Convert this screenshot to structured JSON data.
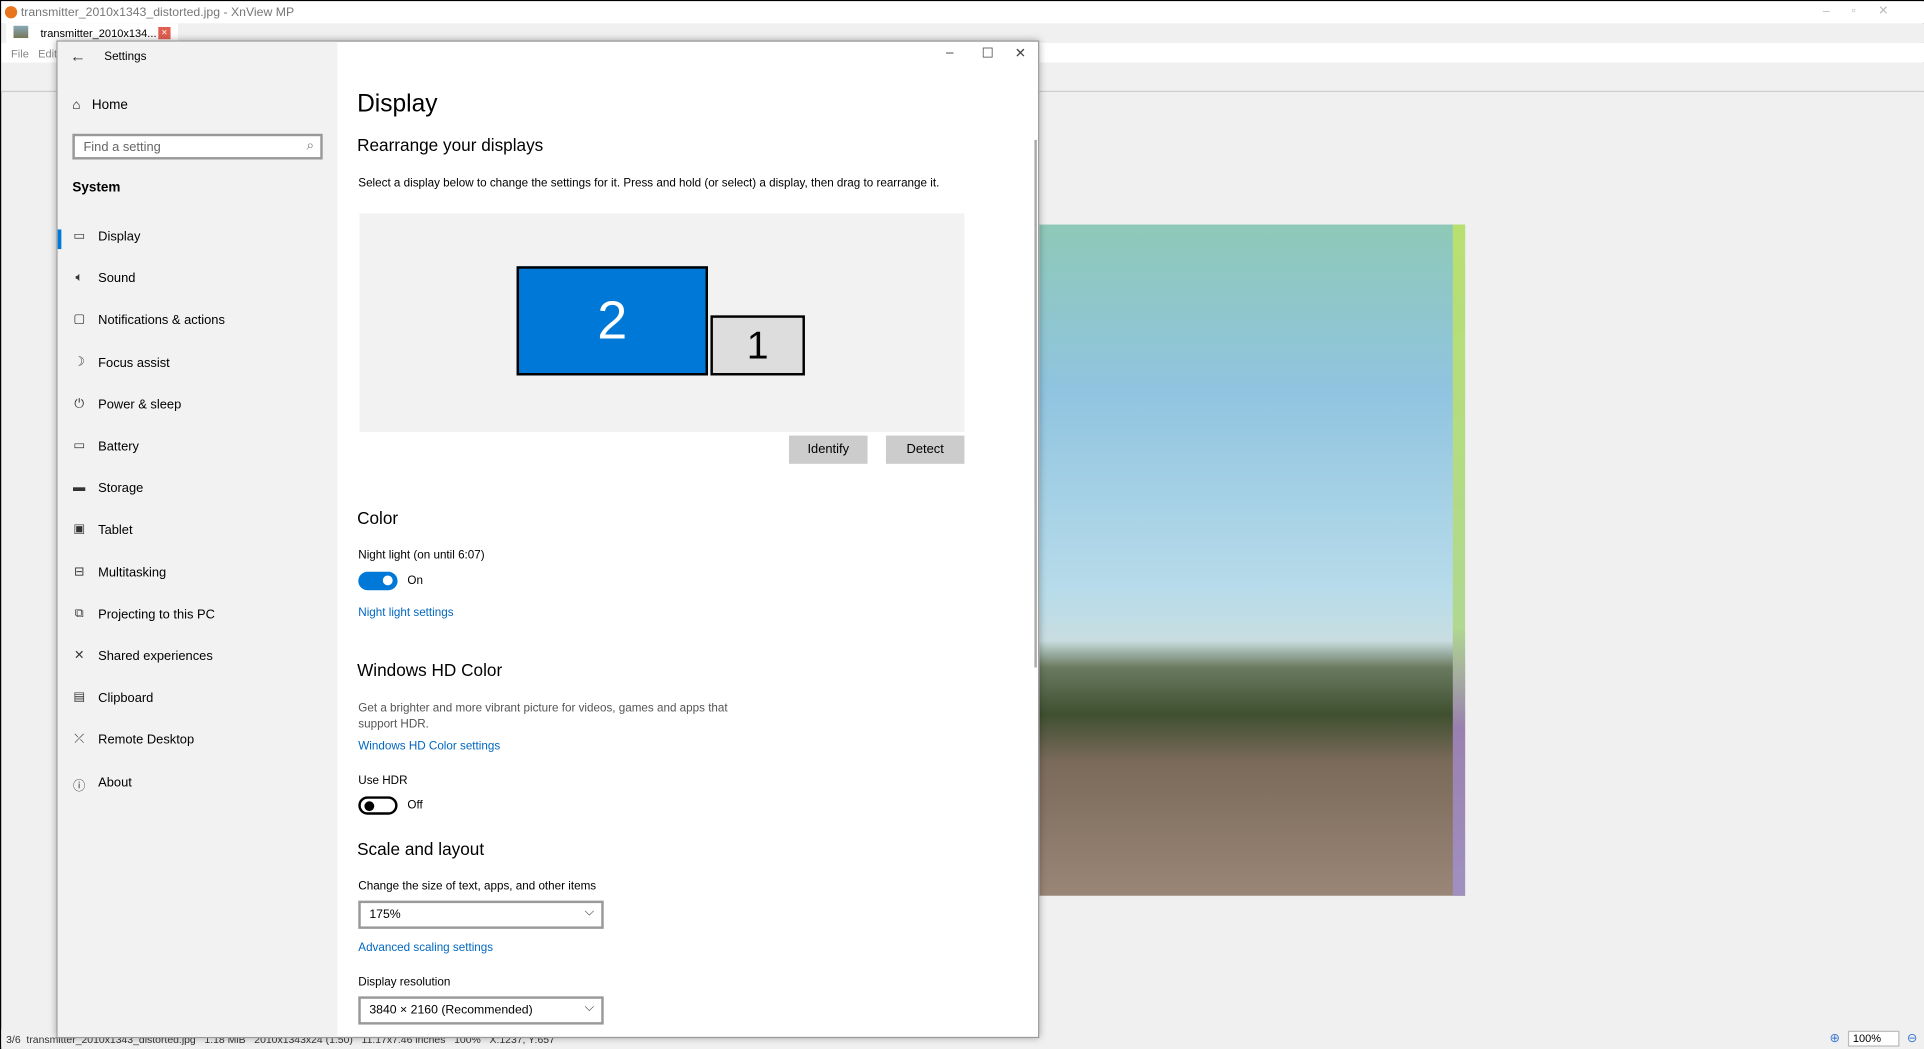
{
  "xnview": {
    "title": "transmitter_2010x1343_distorted.jpg - XnView MP",
    "tab_label": "transmitter_2010x134...",
    "menu": [
      "File",
      "Edit"
    ],
    "status": "3/6  transmitter_2010x1343_distorted.jpg   1.18 MiB   2010x1343x24 (1.50)   11.17x7.46 inches   100%   X:1237, Y:657",
    "zoom": "100%"
  },
  "settings": {
    "window_title": "Settings",
    "home": "Home",
    "search_placeholder": "Find a setting",
    "section": "System",
    "nav": [
      {
        "label": "Display",
        "icon": "monitor-icon"
      },
      {
        "label": "Sound",
        "icon": "speaker-icon"
      },
      {
        "label": "Notifications & actions",
        "icon": "notification-icon"
      },
      {
        "label": "Focus assist",
        "icon": "moon-icon"
      },
      {
        "label": "Power & sleep",
        "icon": "power-icon"
      },
      {
        "label": "Battery",
        "icon": "battery-icon"
      },
      {
        "label": "Storage",
        "icon": "storage-icon"
      },
      {
        "label": "Tablet",
        "icon": "tablet-icon"
      },
      {
        "label": "Multitasking",
        "icon": "multitasking-icon"
      },
      {
        "label": "Projecting to this PC",
        "icon": "projecting-icon"
      },
      {
        "label": "Shared experiences",
        "icon": "shared-icon"
      },
      {
        "label": "Clipboard",
        "icon": "clipboard-icon"
      },
      {
        "label": "Remote Desktop",
        "icon": "remote-desktop-icon"
      },
      {
        "label": "About",
        "icon": "info-icon"
      }
    ],
    "page_title": "Display",
    "rearrange_heading": "Rearrange your displays",
    "rearrange_desc": "Select a display below to change the settings for it. Press and hold (or select) a display, then drag to rearrange it.",
    "monitor_2": "2",
    "monitor_1": "1",
    "identify": "Identify",
    "detect": "Detect",
    "color_heading": "Color",
    "night_light_label": "Night light (on until 6:07)",
    "night_light_state": "On",
    "night_light_link": "Night light settings",
    "hd_heading": "Windows HD Color",
    "hd_desc": "Get a brighter and more vibrant picture for videos, games and apps that support HDR.",
    "hd_link": "Windows HD Color settings",
    "hdr_label": "Use HDR",
    "hdr_state": "Off",
    "scale_heading": "Scale and layout",
    "scale_label": "Change the size of text, apps, and other items",
    "scale_value": "175%",
    "adv_scaling_link": "Advanced scaling settings",
    "resolution_label": "Display resolution",
    "resolution_value": "3840 × 2160 (Recommended)"
  },
  "colors": {
    "accent": "#0078d7",
    "link": "#0067c0"
  }
}
